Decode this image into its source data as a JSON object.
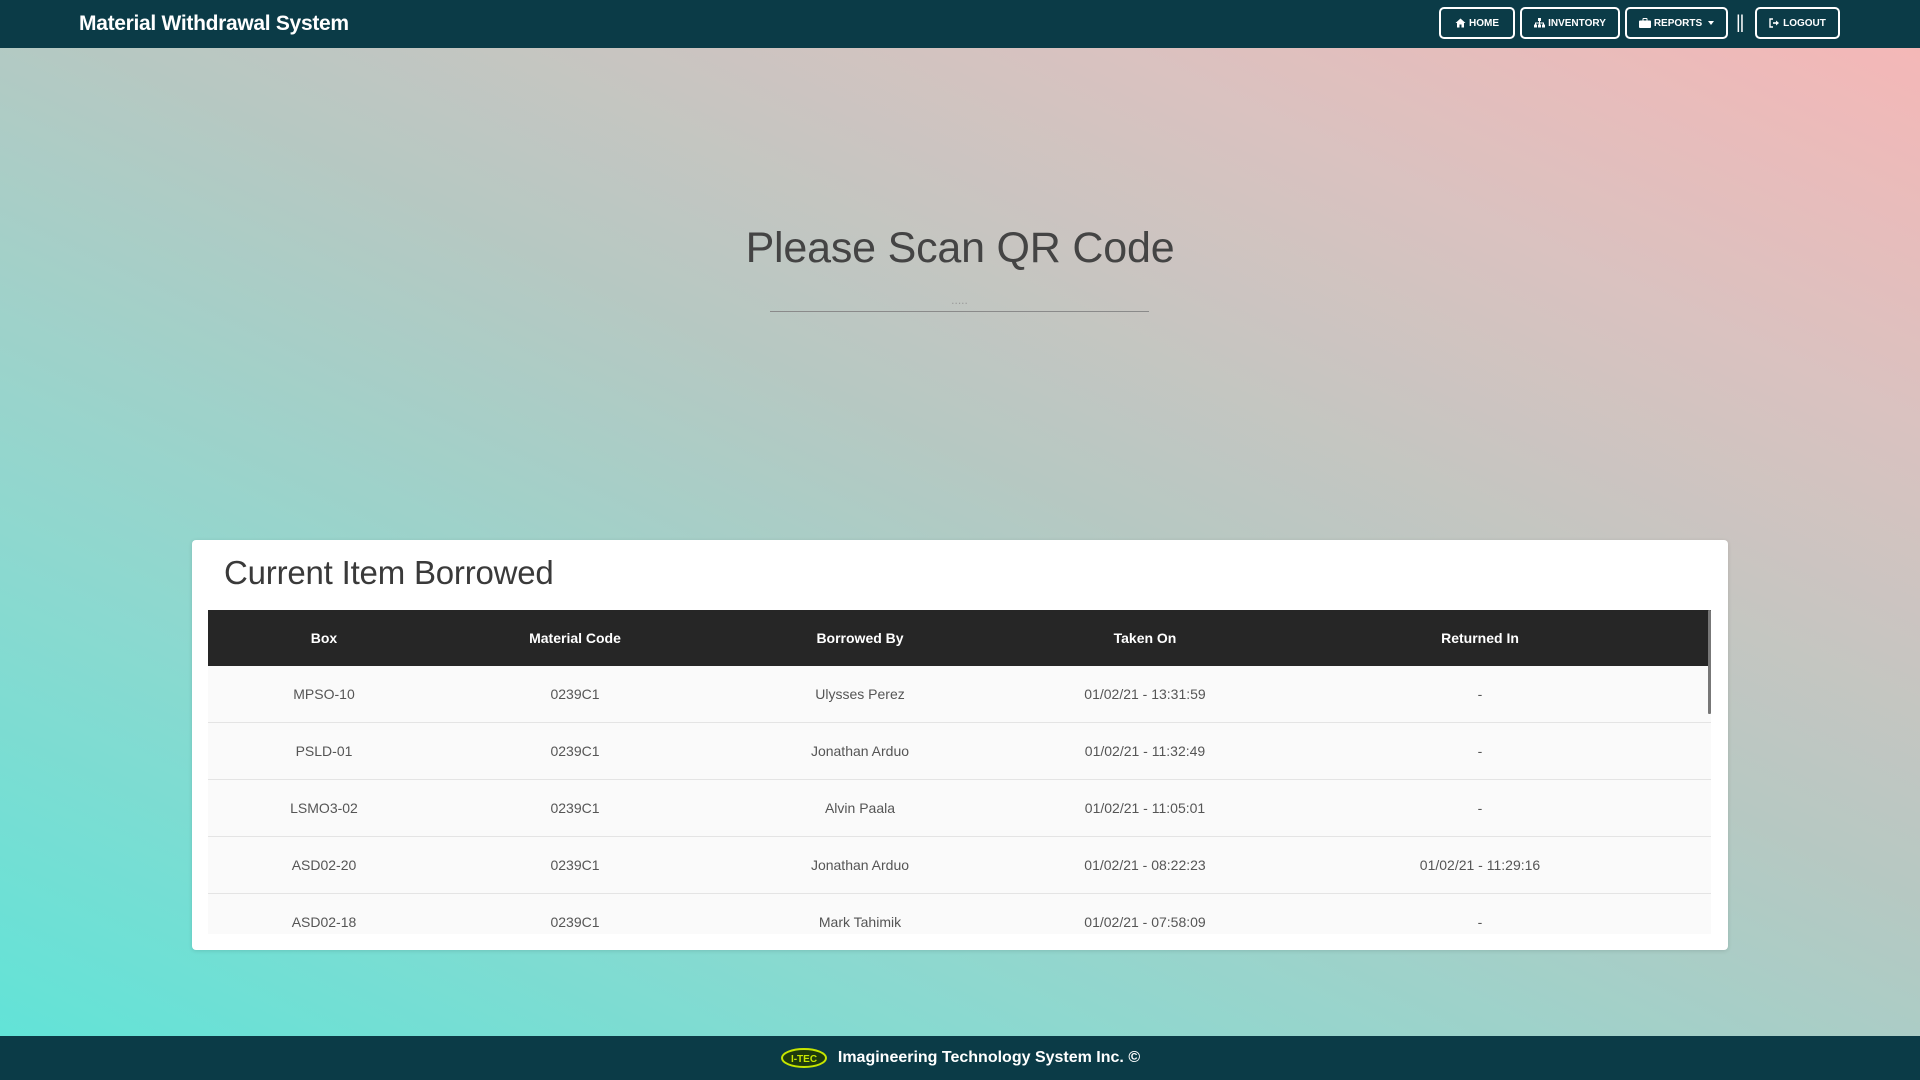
{
  "navbar": {
    "brand": "Material Withdrawal System",
    "buttons": {
      "home": "HOME",
      "inventory": "INVENTORY",
      "reports": "REPORTS",
      "logout": "LOGOUT"
    },
    "separator": "||"
  },
  "scan": {
    "title": "Please Scan QR Code",
    "placeholder": "....."
  },
  "borrowed": {
    "title": "Current Item Borrowed",
    "headers": [
      "Box",
      "Material Code",
      "Borrowed By",
      "Taken On",
      "Returned In"
    ],
    "rows": [
      [
        "MPSO-10",
        "0239C1",
        "Ulysses Perez",
        "01/02/21 - 13:31:59",
        "-"
      ],
      [
        "PSLD-01",
        "0239C1",
        "Jonathan Arduo",
        "01/02/21 - 11:32:49",
        "-"
      ],
      [
        "LSMO3-02",
        "0239C1",
        "Alvin Paala",
        "01/02/21 - 11:05:01",
        "-"
      ],
      [
        "ASD02-20",
        "0239C1",
        "Jonathan Arduo",
        "01/02/21 - 08:22:23",
        "01/02/21 - 11:29:16"
      ],
      [
        "ASD02-18",
        "0239C1",
        "Mark Tahimik",
        "01/02/21 - 07:58:09",
        "-"
      ]
    ]
  },
  "footer": {
    "logo_text": "I-TEC",
    "company": "Imagineering Technology System Inc. ©"
  },
  "colors": {
    "navbar_bg": "#0b3b47",
    "table_header_bg": "#262626",
    "logo_accent": "#c6e600"
  },
  "icons": {
    "home": "home-icon",
    "inventory": "sitemap-icon",
    "reports": "briefcase-icon",
    "logout": "sign-out-icon"
  }
}
